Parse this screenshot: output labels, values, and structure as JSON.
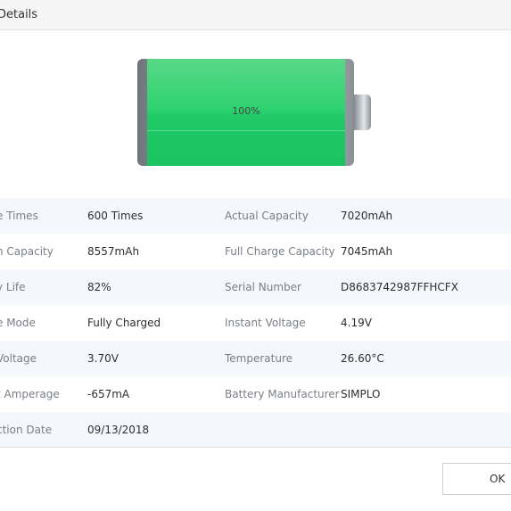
{
  "window": {
    "title": "Details"
  },
  "battery": {
    "level_label": "100%",
    "level": 1.0,
    "fill_color": "#2bd26d"
  },
  "rows": [
    {
      "l1": "e Times",
      "v1": "600 Times",
      "l2": "Actual Capacity",
      "v2": "7020mAh"
    },
    {
      "l1": "n Capacity",
      "v1": "8557mAh",
      "l2": "Full Charge Capacity",
      "v2": "7045mAh"
    },
    {
      "l1": "y Life",
      "v1": "82%",
      "l2": "Serial Number",
      "v2": "D8683742987FFHCFX"
    },
    {
      "l1": "e Mode",
      "v1": "Fully Charged",
      "l2": "Instant Voltage",
      "v2": "4.19V"
    },
    {
      "l1": "Voltage",
      "v1": "3.70V",
      "l2": "Temperature",
      "v2": "26.60°C"
    },
    {
      "l1": "t Amperage",
      "v1": "-657mA",
      "l2": "Battery Manufacturer",
      "v2": "SIMPLO"
    },
    {
      "l1": "ction Date",
      "v1": "09/13/2018",
      "l2": "",
      "v2": ""
    }
  ],
  "footer": {
    "ok_label": "OK"
  }
}
